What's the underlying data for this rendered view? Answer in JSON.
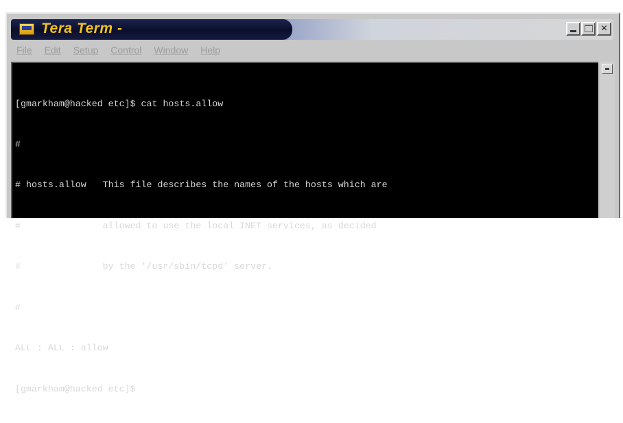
{
  "window": {
    "title": "Tera Term -"
  },
  "menu": {
    "items": [
      "File",
      "Edit",
      "Setup",
      "Control",
      "Window",
      "Help"
    ]
  },
  "terminal": {
    "lines": [
      "[gmarkham@hacked etc]$ cat hosts.allow",
      "#",
      "# hosts.allow   This file describes the names of the hosts which are",
      "#               allowed to use the local INET services, as decided",
      "#               by the '/usr/sbin/tcpd' server.",
      "#",
      "ALL : ALL : allow",
      "[gmarkham@hacked etc]$ "
    ]
  },
  "icons": {
    "app": "tera-term-app-icon",
    "minimize": "minimize-icon",
    "maximize": "maximize-icon",
    "close": "close-icon",
    "scroll_up": "scroll-up-arrow-icon"
  },
  "colors": {
    "title_text": "#f3c21a",
    "terminal_bg": "#000000",
    "terminal_fg": "#d8d8d8",
    "menu_text_disabled": "#9c9c9c"
  }
}
